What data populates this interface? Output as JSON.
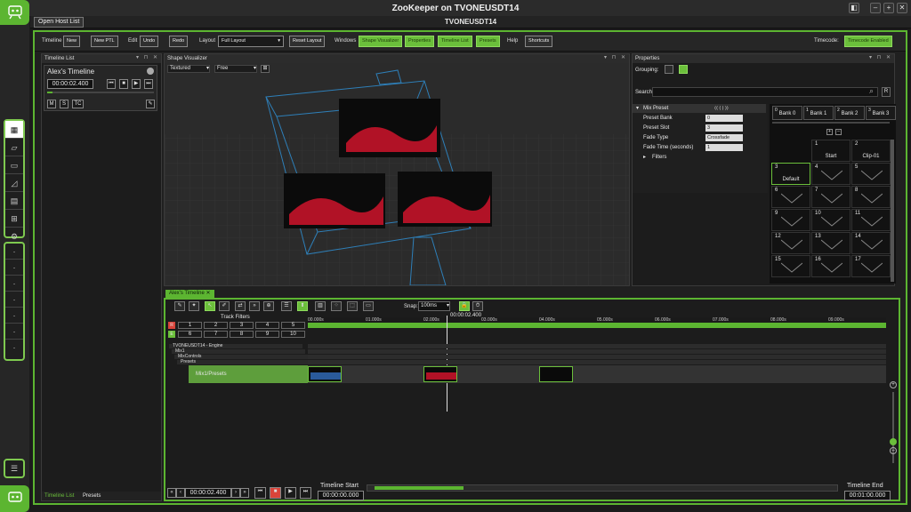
{
  "window": {
    "title": "ZooKeeper on TVONEUSDT14",
    "buttons": [
      "◧",
      "–",
      "+",
      "✕"
    ]
  },
  "host": {
    "button": "Open Host List",
    "title": "TVONEUSDT14"
  },
  "toolbar": {
    "timeline_label": "Timeline",
    "new": "New",
    "new_ptl": "New PTL",
    "edit_label": "Edit",
    "undo": "Undo",
    "redo": "Redo",
    "layout_label": "Layout",
    "layout_value": "Full Layout",
    "reset_layout": "Reset Layout",
    "windows_label": "Windows",
    "windows": [
      "Shape Visualizer",
      "Properties",
      "Timeline List",
      "Presets"
    ],
    "help_label": "Help",
    "shortcuts": "Shortcuts",
    "timecode_label": "Timecode:",
    "timecode_btn": "Timecode Enabled"
  },
  "timeline_list": {
    "title": "Timeline List",
    "name": "Alex's Timeline",
    "time": "00:00:02.400",
    "btn_m": "M",
    "btn_s": "S",
    "btn_tc": "TC",
    "tabs": [
      "Timeline List",
      "Presets"
    ]
  },
  "visualizer": {
    "title": "Shape Visualizer",
    "mode": "Textured",
    "camera": "Free"
  },
  "properties": {
    "title": "Properties",
    "grouping": "Grouping:",
    "search": "Search:",
    "section": "Mix Preset",
    "rows": [
      {
        "label": "Preset Bank",
        "value": "0"
      },
      {
        "label": "Preset Slot",
        "value": "3"
      },
      {
        "label": "Fade Type",
        "value": "Crossfade"
      },
      {
        "label": "Fade Time (seconds)",
        "value": "1"
      }
    ],
    "filters": "Filters",
    "banks": [
      {
        "n": "0",
        "label": "Bank 0"
      },
      {
        "n": "1",
        "label": "Bank 1"
      },
      {
        "n": "2",
        "label": "Bank 2"
      },
      {
        "n": "3",
        "label": "Bank 3"
      }
    ],
    "slots": [
      {
        "n": "1",
        "label": "Start"
      },
      {
        "n": "2",
        "label": "Clip-01"
      },
      {
        "n": "3",
        "label": "Default"
      },
      {
        "n": "4",
        "label": ""
      },
      {
        "n": "5",
        "label": ""
      },
      {
        "n": "6",
        "label": ""
      },
      {
        "n": "7",
        "label": ""
      },
      {
        "n": "8",
        "label": ""
      },
      {
        "n": "9",
        "label": ""
      },
      {
        "n": "10",
        "label": ""
      },
      {
        "n": "11",
        "label": ""
      },
      {
        "n": "12",
        "label": ""
      },
      {
        "n": "13",
        "label": ""
      },
      {
        "n": "14",
        "label": ""
      },
      {
        "n": "15",
        "label": ""
      },
      {
        "n": "16",
        "label": ""
      },
      {
        "n": "17",
        "label": ""
      }
    ]
  },
  "timeline": {
    "tab": "Alex's Timeline",
    "snap_label": "Snap:",
    "snap_value": "100ms",
    "track_filters": "Track Filters",
    "filter_numbers": [
      "1",
      "2",
      "3",
      "4",
      "5",
      "6",
      "7",
      "8",
      "9",
      "10"
    ],
    "playhead": "00:00:02.400",
    "ticks": [
      "00.000s",
      "01.000s",
      "02.000s",
      "03.000s",
      "04.000s",
      "05.000s",
      "06.000s",
      "07.000s",
      "08.000s",
      "09.000s"
    ],
    "tracks": [
      "TVONEUSDT14 - Engine",
      "Mix1",
      "MixControls",
      "Presets"
    ],
    "layer": "Mix1/Presets",
    "current_time": "00:00:02.400",
    "start_label": "Timeline Start",
    "start_time": "00:00:00.000",
    "end_label": "Timeline End",
    "end_time": "00:01:00.000"
  }
}
